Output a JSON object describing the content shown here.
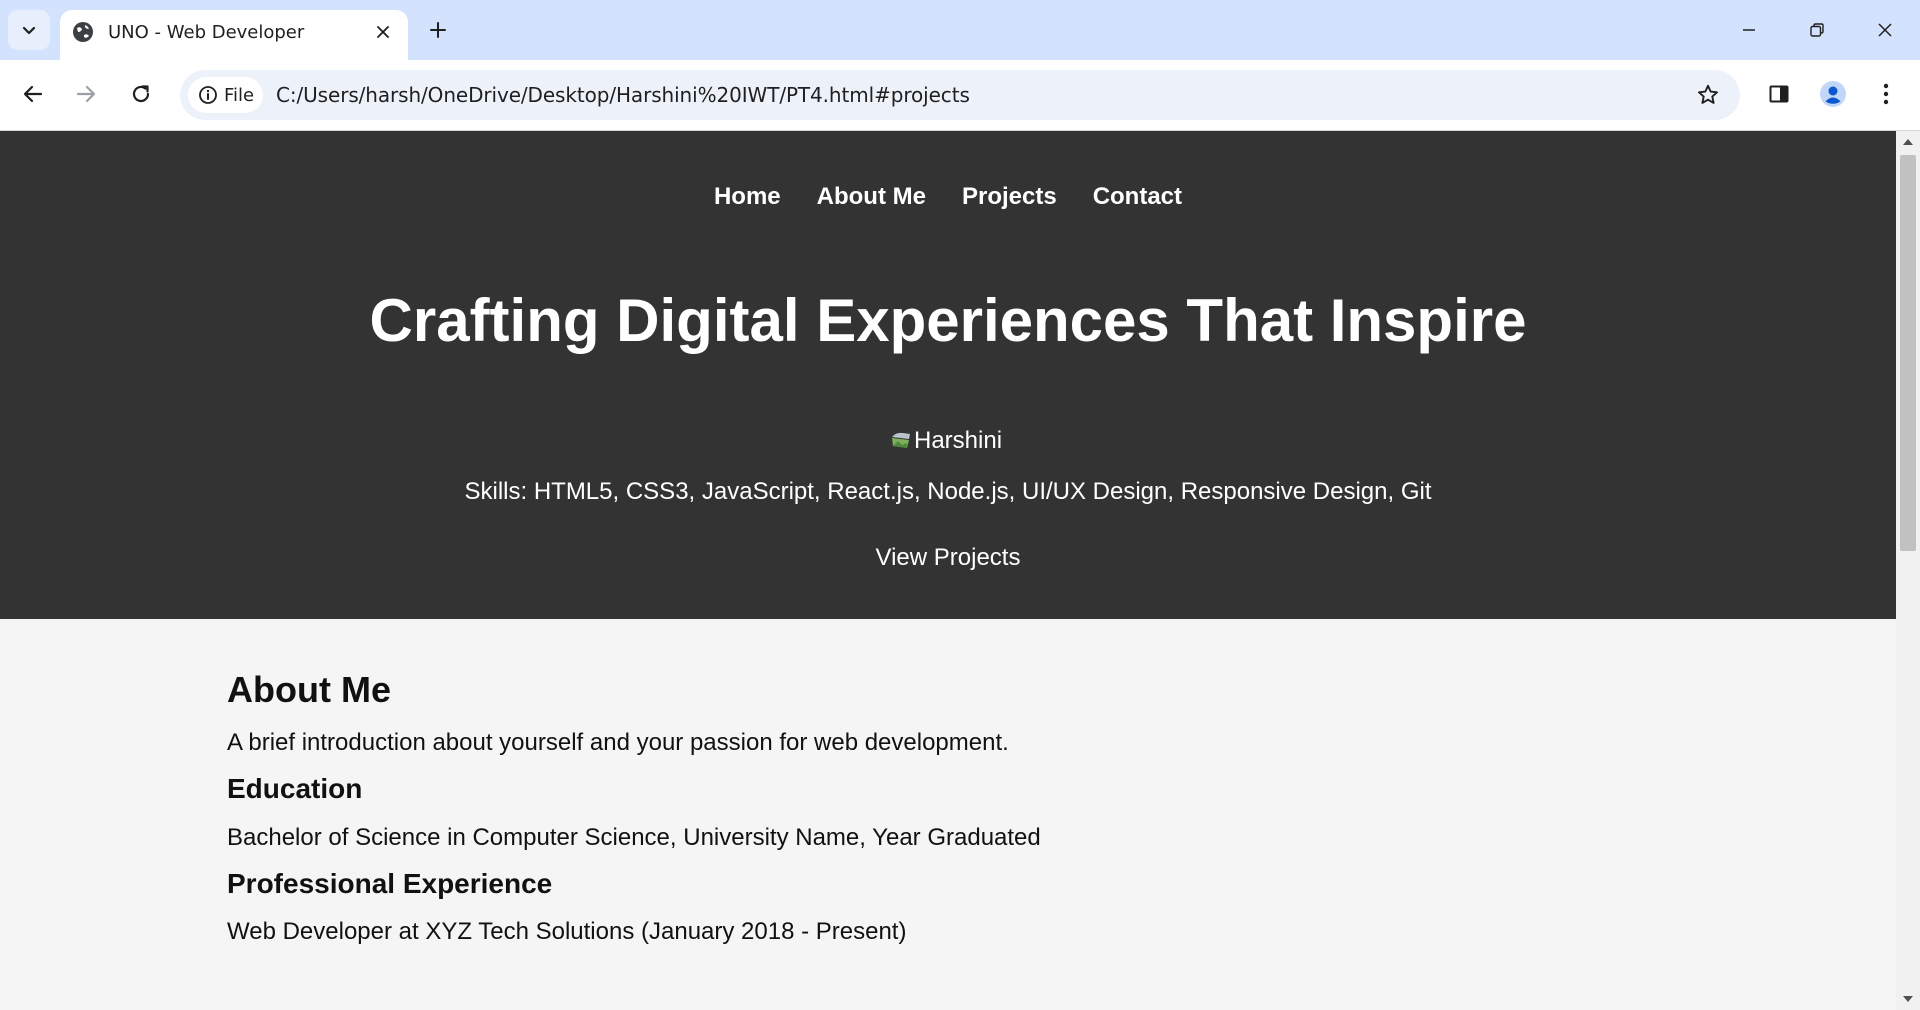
{
  "browser": {
    "tab_title": "UNO - Web Developer",
    "chip_label": "File",
    "url": "C:/Users/harsh/OneDrive/Desktop/Harshini%20IWT/PT4.html#projects"
  },
  "page": {
    "nav": [
      "Home",
      "About Me",
      "Projects",
      "Contact"
    ],
    "headline": "Crafting Digital Experiences That Inspire",
    "profile_alt": "Harshini",
    "skills": "Skills: HTML5, CSS3, JavaScript, React.js, Node.js, UI/UX Design, Responsive Design, Git",
    "cta": "View Projects",
    "about": {
      "title": "About Me",
      "intro": "A brief introduction about yourself and your passion for web development.",
      "education_title": "Education",
      "education": "Bachelor of Science in Computer Science, University Name, Year Graduated",
      "experience_title": "Professional Experience",
      "experience": "Web Developer at XYZ Tech Solutions (January 2018 - Present)"
    }
  },
  "colors": {
    "hero_bg": "#333333",
    "page_bg": "#f5f5f5",
    "tabstrip_bg": "#d3e3fd",
    "omnibox_bg": "#edf2fa"
  },
  "icons": {
    "tab_search": "chevron-down-icon",
    "favicon": "globe-icon",
    "tab_close": "close-icon",
    "new_tab": "plus-icon",
    "minimize": "minimize-icon",
    "restore": "restore-icon",
    "close_window": "close-icon",
    "back": "arrow-left-icon",
    "forward": "arrow-right-icon",
    "reload": "reload-icon",
    "site_info": "info-icon",
    "bookmark": "star-icon",
    "side_panel": "side-panel-icon",
    "profile": "profile-icon",
    "menu": "kebab-menu-icon"
  }
}
